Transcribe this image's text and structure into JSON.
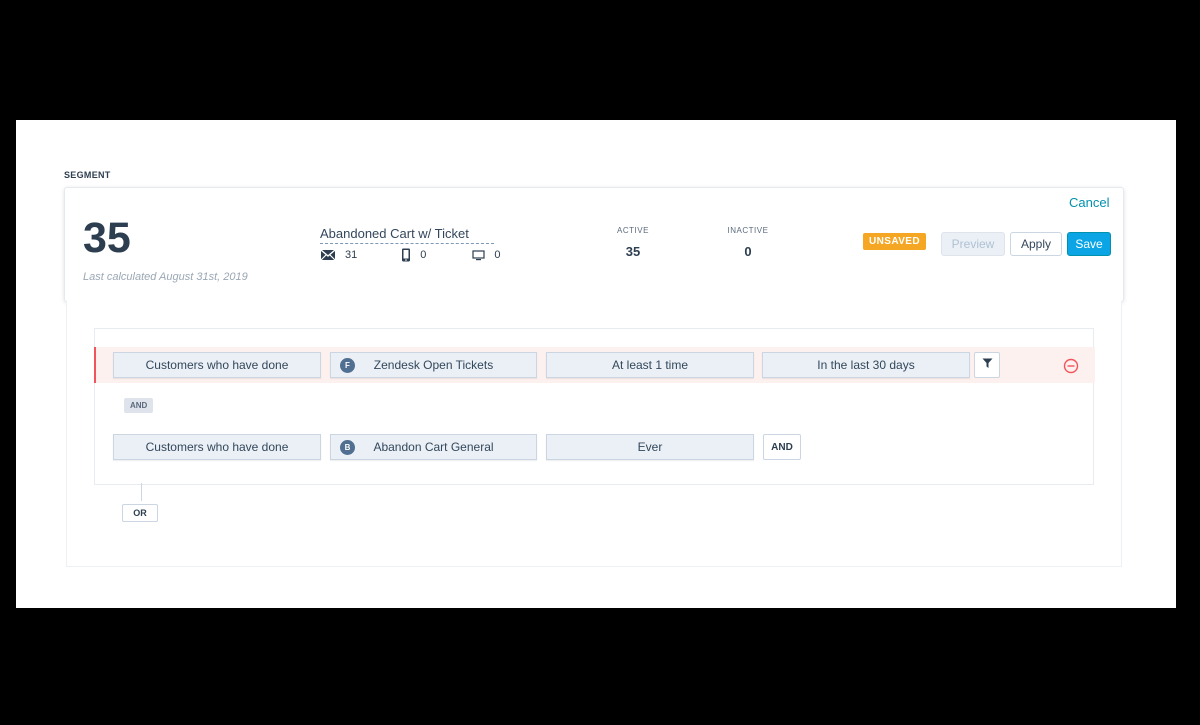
{
  "section_label": "SEGMENT",
  "summary": {
    "count": "35",
    "last_calculated": "Last calculated August 31st, 2019"
  },
  "segment": {
    "name": "Abandoned Cart w/ Ticket",
    "email_count": "31",
    "mobile_count": "0",
    "web_count": "0"
  },
  "stats": {
    "active_label": "ACTIVE",
    "active_value": "35",
    "inactive_label": "INACTIVE",
    "inactive_value": "0"
  },
  "actions": {
    "cancel": "Cancel",
    "status_badge": "UNSAVED",
    "preview": "Preview",
    "apply": "Apply",
    "save": "Save"
  },
  "filters": [
    {
      "subject": "Customers who have done",
      "event_badge": "F",
      "event": "Zendesk Open Tickets",
      "frequency": "At least 1 time",
      "timeframe": "In the last 30 days"
    },
    {
      "subject": "Customers who have done",
      "event_badge": "B",
      "event": "Abandon Cart General",
      "frequency": "Ever"
    }
  ],
  "connectors": {
    "and_tag": "AND",
    "and_button": "AND",
    "or_button": "OR"
  },
  "colors": {
    "primary": "#0ba5e6",
    "warning": "#f5a623",
    "danger": "#f2545b",
    "chip_bg": "#eaf0f6"
  }
}
